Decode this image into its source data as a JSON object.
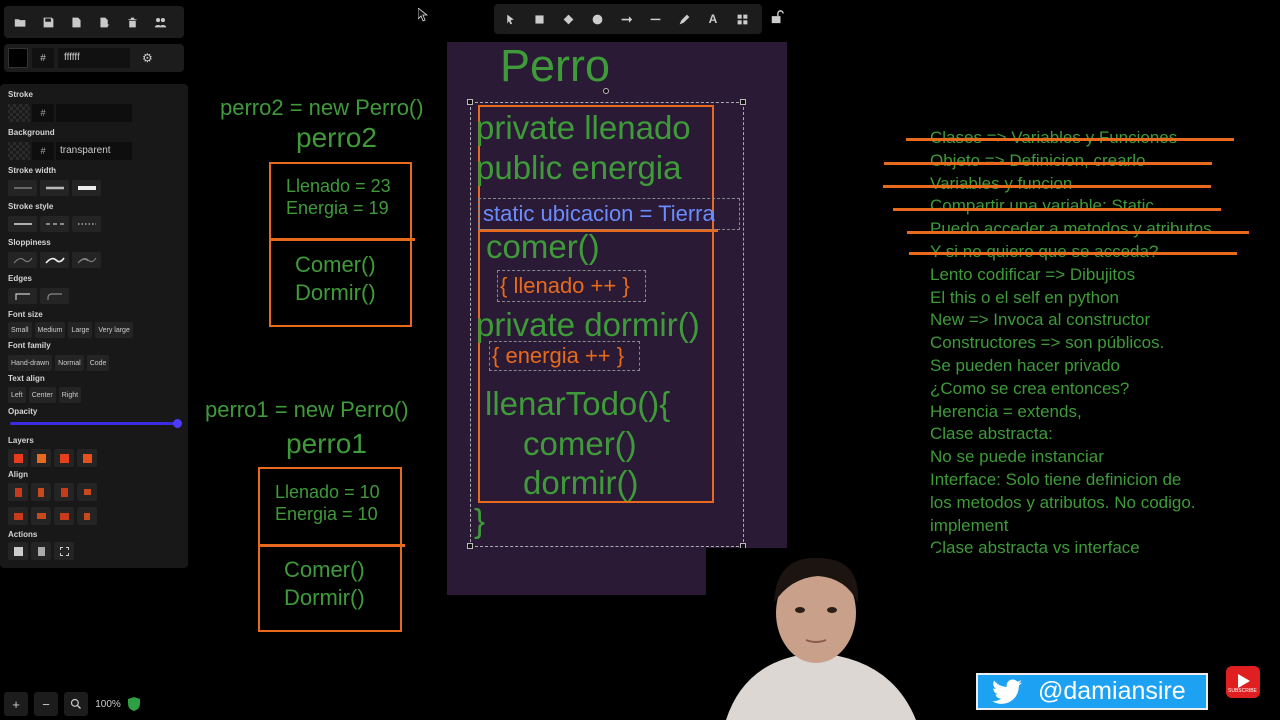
{
  "app": {
    "zoom": "100%",
    "color": {
      "hash": "#",
      "value": "ffffff"
    }
  },
  "properties": {
    "stroke_label": "Stroke",
    "stroke_hash": "#",
    "stroke_value": "",
    "background_label": "Background",
    "background_hash": "#",
    "background_value": "transparent",
    "stroke_width_label": "Stroke width",
    "stroke_style_label": "Stroke style",
    "sloppiness_label": "Sloppiness",
    "edges_label": "Edges",
    "font_size_label": "Font size",
    "font_sizes": [
      "Small",
      "Medium",
      "Large",
      "Very large"
    ],
    "font_family_label": "Font family",
    "font_families": [
      "Hand-drawn",
      "Normal",
      "Code"
    ],
    "text_align_label": "Text align",
    "text_aligns": [
      "Left",
      "Center",
      "Right"
    ],
    "opacity_label": "Opacity",
    "opacity": 100,
    "layers_label": "Layers",
    "align_label": "Align",
    "actions_label": "Actions"
  },
  "toolbar_icons": [
    "open-icon",
    "save-icon",
    "export-icon",
    "export-image-icon",
    "trash-icon",
    "collab-icon"
  ],
  "tools": [
    "selection-tool",
    "rectangle-tool",
    "diamond-tool",
    "ellipse-tool",
    "arrow-tool",
    "line-tool",
    "draw-tool",
    "text-tool",
    "library-tool"
  ],
  "canvas": {
    "perro2": {
      "title": "perro2 = new Perro()",
      "name": "perro2",
      "attrs": [
        "Llenado = 23",
        "Energia = 19"
      ],
      "methods": [
        "Comer()",
        "Dormir()"
      ]
    },
    "perro1": {
      "title": "perro1 = new Perro()",
      "name": "perro1",
      "attrs": [
        "Llenado = 10",
        "Energia = 10"
      ],
      "methods": [
        "Comer()",
        "Dormir()"
      ]
    },
    "clase": {
      "title": "Perro",
      "attr1": "private llenado",
      "attr2": "public energia",
      "static_line": "static ubicacion = Tierra",
      "comer": "comer()",
      "llenado_body": "{ llenado ++ }",
      "dormir": "private dormir()",
      "energia_body": "{ energia ++ }",
      "llenar": "llenarTodo(){",
      "llenar_comer": "comer()",
      "llenar_dormir": "dormir()",
      "close": "}"
    },
    "notes": [
      "Clases => Variables y Funciones",
      "Objeto => Definicion, crearlo",
      "Variables y funcion",
      "Compartir una variable: Static",
      "Puedo acceder a metodos y atributos",
      "Y si no quiero que se acceda?",
      "Lento codificar => Dibujitos",
      "El this o el self en python",
      "New => Invoca al constructor",
      "Constructores => son públicos.",
      "Se pueden hacer privado",
      "¿Como se crea entonces?",
      "Herencia = extends,",
      "Clase abstracta:",
      "No se puede instanciar",
      "Interface: Solo tiene definicion de",
      "los metodos y atributos. No codigo.",
      "implement",
      "Clase abstracta vs interface"
    ]
  },
  "overlay": {
    "twitter_handle": "@damiansire",
    "youtube_label": "SUBSCRIBE"
  },
  "colors": {
    "green": "#3f9a3a",
    "orange": "#e86a1c",
    "blue": "#6b8cff",
    "purple_bg": "#2a1a35",
    "twitter": "#1da1f2"
  }
}
